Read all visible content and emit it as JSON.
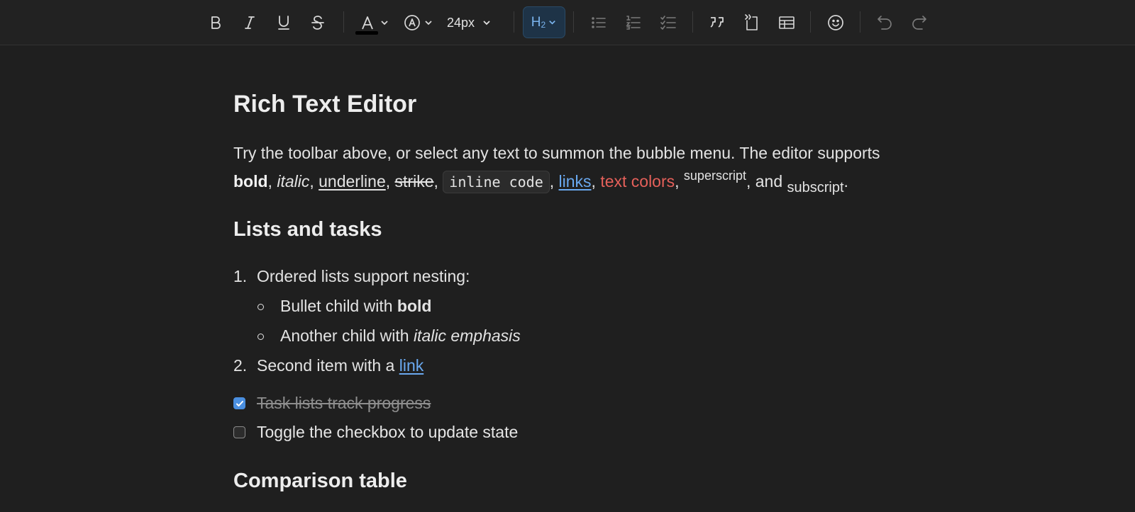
{
  "toolbar": {
    "font_size": "24px",
    "heading_main": "H",
    "heading_sub": "2"
  },
  "editor": {
    "title": "Rich Text Editor",
    "intro": {
      "lead": "Try the toolbar above, or select any text to summon the bubble menu. The editor supports",
      "bold": "bold",
      "italic": "italic",
      "underline": "underline",
      "strike": "strike",
      "code": "inline code",
      "links": "links",
      "colors": "text colors",
      "superscript": "superscript",
      "and": ", and",
      "subscript": "subscript",
      "end": "."
    },
    "lists_heading": "Lists and tasks",
    "ordered": [
      {
        "num": "1.",
        "text": "Ordered lists support nesting:"
      },
      {
        "num": "2.",
        "text": "Second item with a",
        "link": "link"
      }
    ],
    "bullets": [
      {
        "text": "Bullet child with",
        "emph": "bold"
      },
      {
        "text": "Another child with",
        "emph": "italic emphasis"
      }
    ],
    "tasks": [
      {
        "text": "Task lists track progress",
        "checked": true
      },
      {
        "text": "Toggle the checkbox to update state",
        "checked": false
      }
    ],
    "table_heading": "Comparison table"
  },
  "colors": {
    "background": "#1f1f1f",
    "accent": "#4a8fe0",
    "link": "#6aa9f0",
    "red_text": "#e5605a"
  }
}
